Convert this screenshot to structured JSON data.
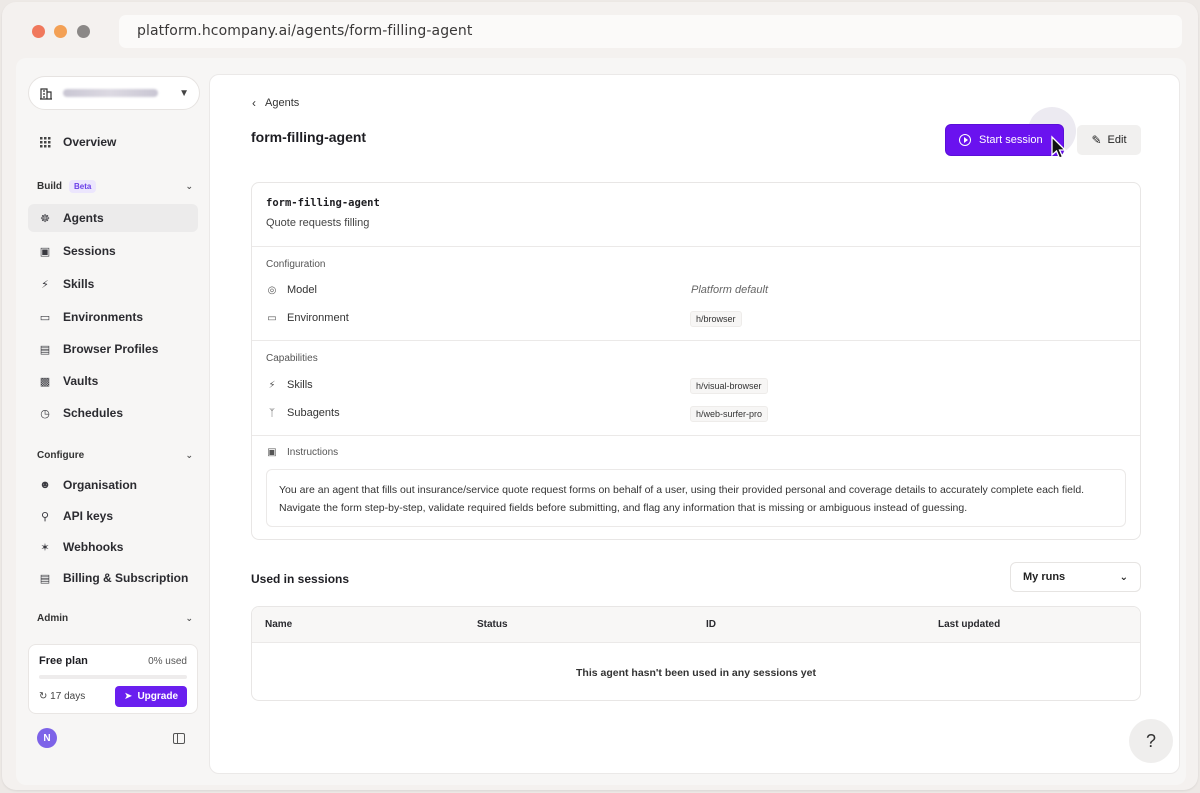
{
  "browser": {
    "url": "platform.hcompany.ai/agents/form-filling-agent"
  },
  "sidebar": {
    "overview": "Overview",
    "build": {
      "label": "Build",
      "badge": "Beta"
    },
    "build_items": [
      {
        "label": "Agents"
      },
      {
        "label": "Sessions"
      },
      {
        "label": "Skills"
      },
      {
        "label": "Environments"
      },
      {
        "label": "Browser Profiles"
      },
      {
        "label": "Vaults"
      },
      {
        "label": "Schedules"
      }
    ],
    "configure": {
      "label": "Configure"
    },
    "configure_items": [
      {
        "label": "Organisation"
      },
      {
        "label": "API keys"
      },
      {
        "label": "Webhooks"
      },
      {
        "label": "Billing & Subscription"
      }
    ],
    "admin": {
      "label": "Admin"
    },
    "plan": {
      "title": "Free plan",
      "used": "0% used",
      "days": "17 days",
      "upgrade": "Upgrade"
    },
    "avatar_initial": "N"
  },
  "header": {
    "back_label": "Agents",
    "title": "form-filling-agent",
    "start_label": "Start session",
    "edit_label": "Edit"
  },
  "agent": {
    "name": "form-filling-agent",
    "description": "Quote requests filling",
    "configuration": {
      "label": "Configuration",
      "model_label": "Model",
      "model_value": "Platform default",
      "environment_label": "Environment",
      "environment_value": "h/browser"
    },
    "capabilities": {
      "label": "Capabilities",
      "skills_label": "Skills",
      "skills_value": "h/visual-browser",
      "subagents_label": "Subagents",
      "subagents_value": "h/web-surfer-pro"
    },
    "instructions": {
      "label": "Instructions",
      "text": "You are an agent that fills out insurance/service quote request forms on behalf of a user, using their provided personal and coverage details to accurately complete each field. Navigate the form step-by-step, validate required fields before submitting, and flag any information that is missing or ambiguous instead of guessing."
    }
  },
  "sessions": {
    "title": "Used in sessions",
    "filter": "My runs",
    "columns": [
      "Name",
      "Status",
      "ID",
      "Last updated"
    ],
    "empty": "This agent hasn't been used in any sessions yet"
  },
  "help_label": "?",
  "colors": {
    "accent": "#6a12ef",
    "avatar": "#7d63e8",
    "beta_text": "#6b3fe8"
  }
}
